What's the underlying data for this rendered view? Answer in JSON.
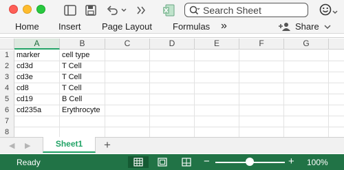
{
  "toolbar": {
    "search_placeholder": "Search Sheet"
  },
  "ribbon": {
    "tabs": [
      "Home",
      "Insert",
      "Page Layout",
      "Formulas"
    ],
    "more": "»",
    "share_label": "Share"
  },
  "sheet": {
    "columns": [
      "A",
      "B",
      "C",
      "D",
      "E",
      "F",
      "G"
    ],
    "selected_column": "A",
    "rows": [
      {
        "num": "1",
        "a": "marker",
        "b": "cell type"
      },
      {
        "num": "2",
        "a": "cd3d",
        "b": "T Cell"
      },
      {
        "num": "3",
        "a": "cd3e",
        "b": "T Cell"
      },
      {
        "num": "4",
        "a": "cd8",
        "b": "T Cell"
      },
      {
        "num": "5",
        "a": "cd19",
        "b": "B Cell"
      },
      {
        "num": "6",
        "a": "cd235a",
        "b": "Erythrocyte"
      },
      {
        "num": "7",
        "a": "",
        "b": ""
      },
      {
        "num": "8",
        "a": "",
        "b": ""
      }
    ]
  },
  "tabs_bar": {
    "sheet_name": "Sheet1",
    "add_label": "+"
  },
  "status": {
    "text": "Ready",
    "zoom_minus": "−",
    "zoom_plus": "+",
    "zoom_level": "100%",
    "zoom_fraction": 0.5
  },
  "colors": {
    "accent": "#217346",
    "tab_green": "#21a366"
  }
}
